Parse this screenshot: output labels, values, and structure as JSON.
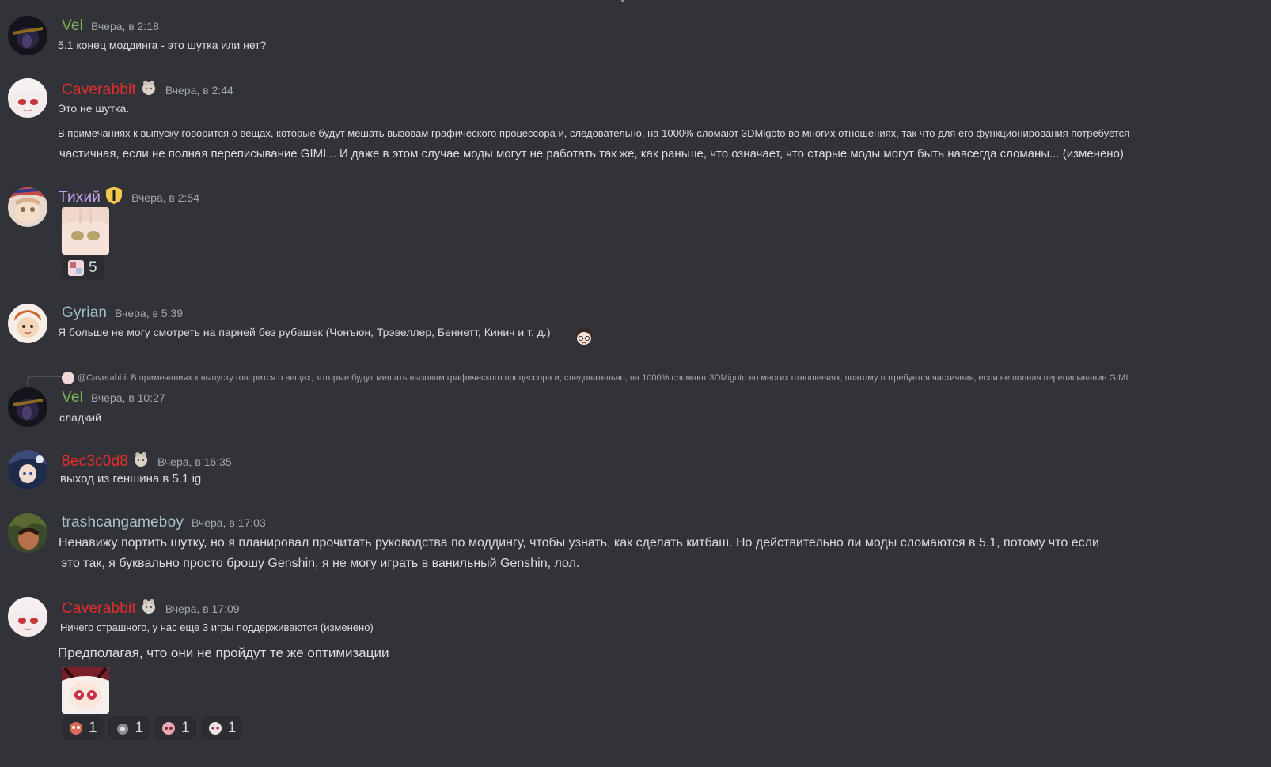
{
  "colors": {
    "background": "#313338",
    "text": "#dbdee1",
    "timestamp": "#a4a8b0",
    "vel": "#7bb454",
    "red_user": "#e52d2d",
    "tikhiy": "#c7a4f0",
    "gyrian": "#9fbcc6",
    "trash": "#a9c0c6",
    "reaction_bg": "#2b2d31"
  },
  "messages": [
    {
      "author": "Vel",
      "time": "Вчера, в 2:18",
      "lines": [
        "5.1 конец моддинга - это шутка или нет?"
      ]
    },
    {
      "author": "Caverabbit",
      "role_icon": "bunny-badge-icon",
      "time": "Вчера, в 2:44",
      "lines": [
        "Это не шутка.",
        "В примечаниях к выпуску говорится о вещах, которые будут мешать вызовам графического процессора и, следовательно, на 1000% сломают 3DMigoto во многих отношениях, так что для его функционирования потребуется",
        "частичная, если не полная переписывание GIMI... И даже в этом случае моды могут не работать так же, как раньше, что означает, что старые моды могут быть навсегда сломаны... (изменено)"
      ]
    },
    {
      "author": "Тихий",
      "role_icon": "shield-badge-icon",
      "time": "Вчера, в 2:54",
      "reactions": [
        {
          "emoji": "sticker-emoji-icon",
          "count": "5"
        }
      ]
    },
    {
      "author": "Gyrian",
      "time": "Вчера, в 5:39",
      "lines": [
        "Я больше не могу смотреть на парней без рубашек (Чонъюн, Трэвеллер, Беннетт, Кинич и т. д.)"
      ]
    },
    {
      "author": "Vel",
      "time": "Вчера, в 10:27",
      "reply_preview": "@Caverabbit В примечаниях к выпуску говорится о вещах, которые будут мешать вызовам графического процессора и, следовательно, на 1000% сломают 3DMigoto во многих отношениях, поэтому потребуется частичная, если не полная переписывание GIMI...",
      "lines": [
        "сладкий"
      ]
    },
    {
      "author": "8ec3c0d8",
      "role_icon": "bunny-badge-icon",
      "time": "Вчера, в 16:35",
      "lines": [
        "выход из геншина в 5.1 ig"
      ]
    },
    {
      "author": "trashcangameboy",
      "time": "Вчера, в 17:03",
      "lines": [
        "Ненавижу портить шутку, но я планировал прочитать руководства по моддингу, чтобы узнать, как сделать китбаш. Но действительно ли моды сломаются в 5.1, потому что если",
        "это так, я буквально просто брошу Genshin, я не могу играть в ванильный Genshin, лол."
      ]
    },
    {
      "author": "Caverabbit",
      "role_icon": "bunny-badge-icon",
      "time": "Вчера, в 17:09",
      "lines": [
        "Ничего страшного, у нас еще 3 игры поддерживаются (изменено)",
        "Предполагая, что они не пройдут те же оптимизации"
      ],
      "reactions": [
        {
          "emoji": "red-sticker-emoji-icon",
          "count": "1"
        },
        {
          "emoji": "grey-sticker-emoji-icon",
          "count": "1"
        },
        {
          "emoji": "pink-sticker-emoji-icon",
          "count": "1"
        },
        {
          "emoji": "white-sticker-emoji-icon",
          "count": "1"
        }
      ]
    }
  ]
}
